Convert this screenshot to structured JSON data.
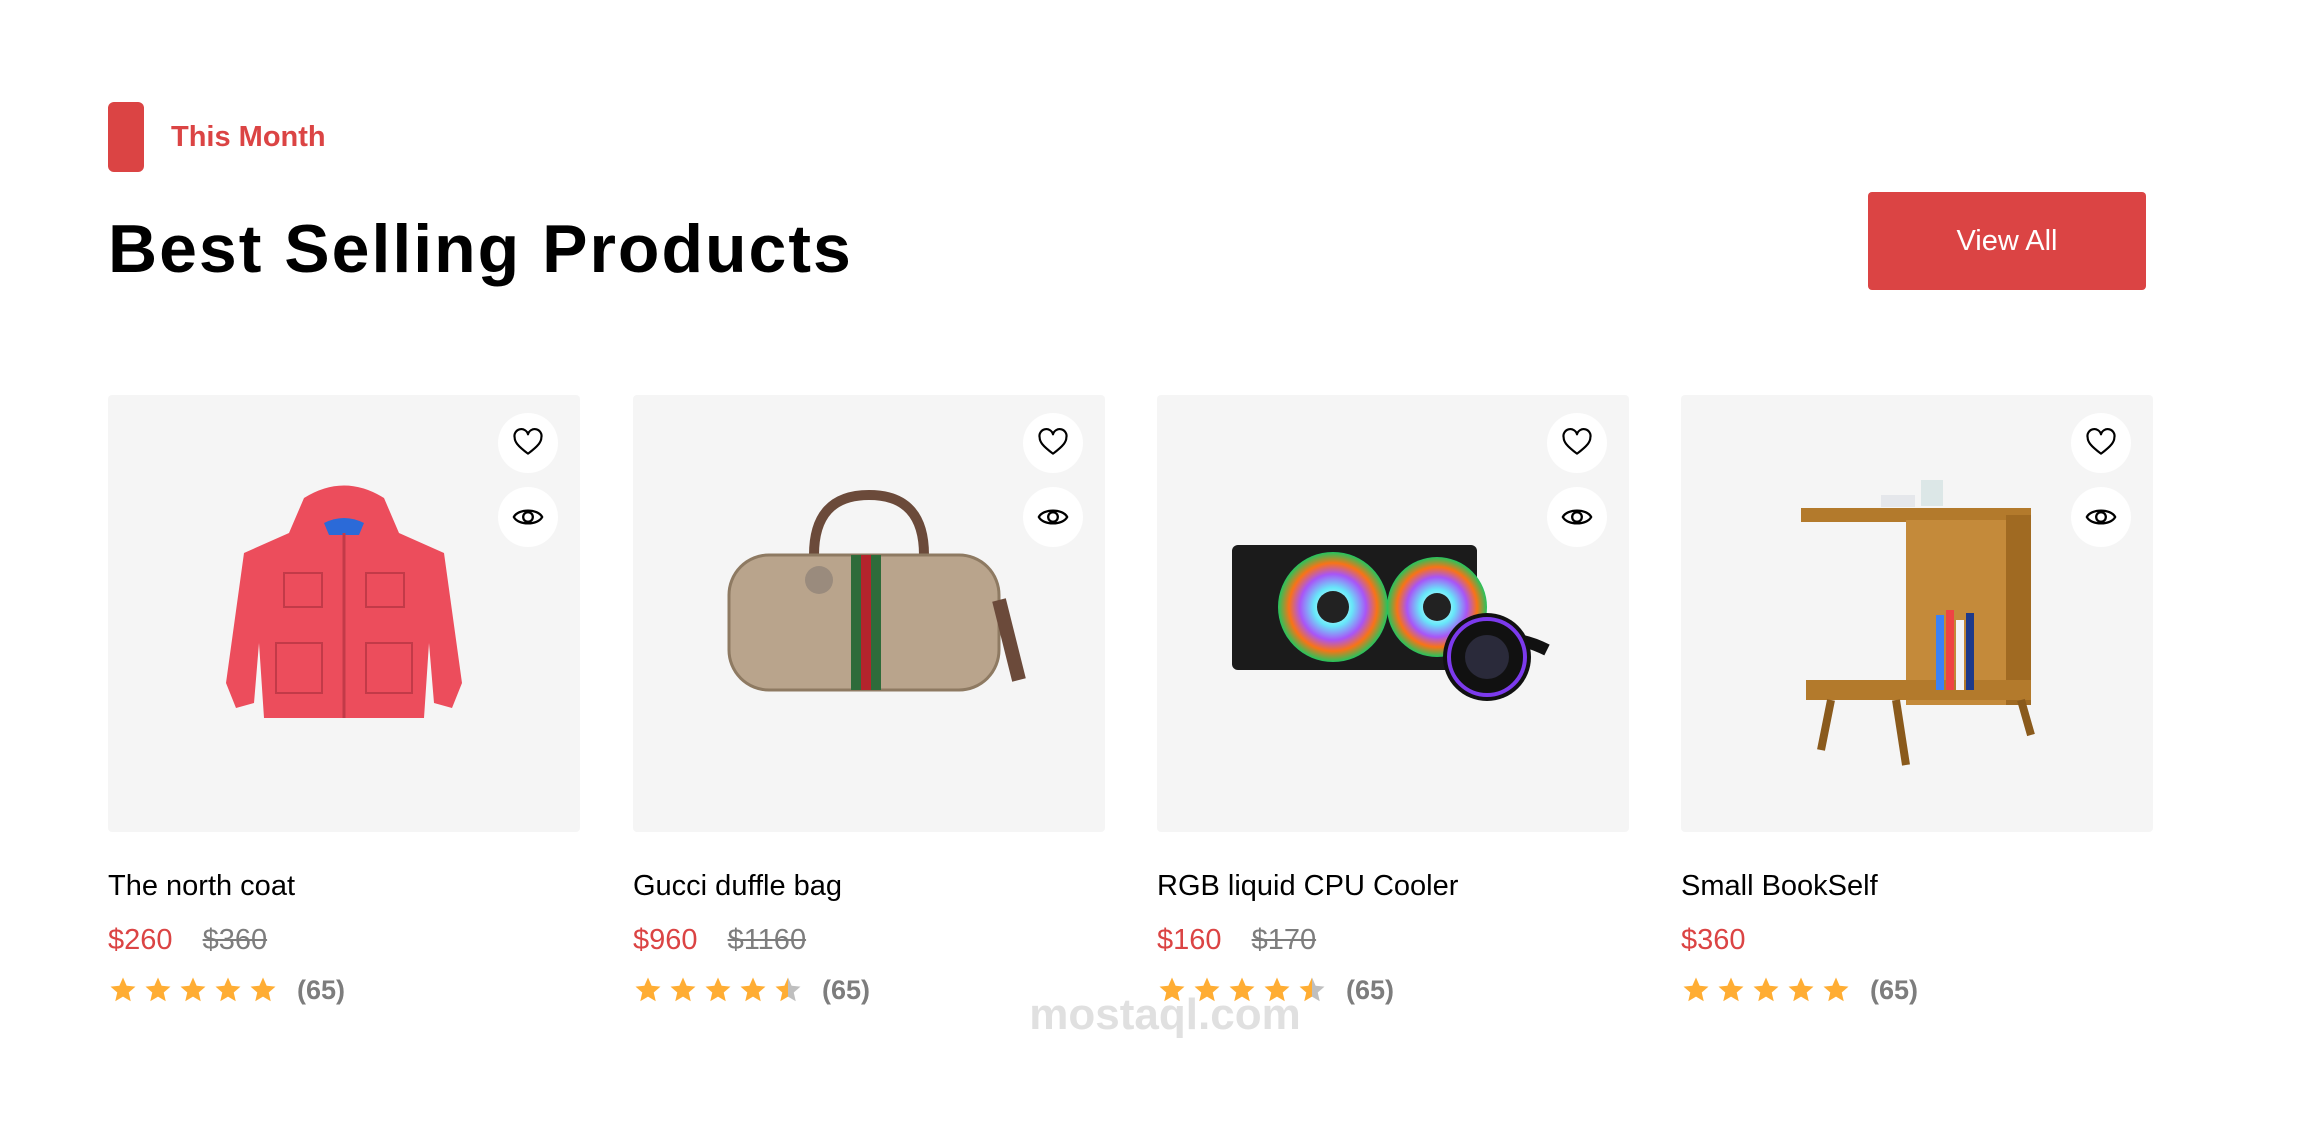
{
  "section": {
    "tag_label": "This Month",
    "title": "Best Selling Products",
    "view_all_label": "View All"
  },
  "colors": {
    "accent": "#db4444",
    "card_bg": "#f5f5f5",
    "star": "#ffad33",
    "star_empty": "#bfbfbf",
    "muted": "#7d7d7d"
  },
  "products": [
    {
      "name": "The north coat",
      "price": "$260",
      "old_price": "$360",
      "rating": 5,
      "reviews": "(65)",
      "icon": "coat-image"
    },
    {
      "name": "Gucci duffle bag",
      "price": "$960",
      "old_price": "$1160",
      "rating": 4.5,
      "reviews": "(65)",
      "icon": "bag-image"
    },
    {
      "name": "RGB liquid CPU Cooler",
      "price": "$160",
      "old_price": "$170",
      "rating": 4.5,
      "reviews": "(65)",
      "icon": "cooler-image"
    },
    {
      "name": "Small BookSelf",
      "price": "$360",
      "old_price": "",
      "rating": 5,
      "reviews": "(65)",
      "icon": "bookshelf-image"
    }
  ],
  "watermark": "mostaql.com"
}
